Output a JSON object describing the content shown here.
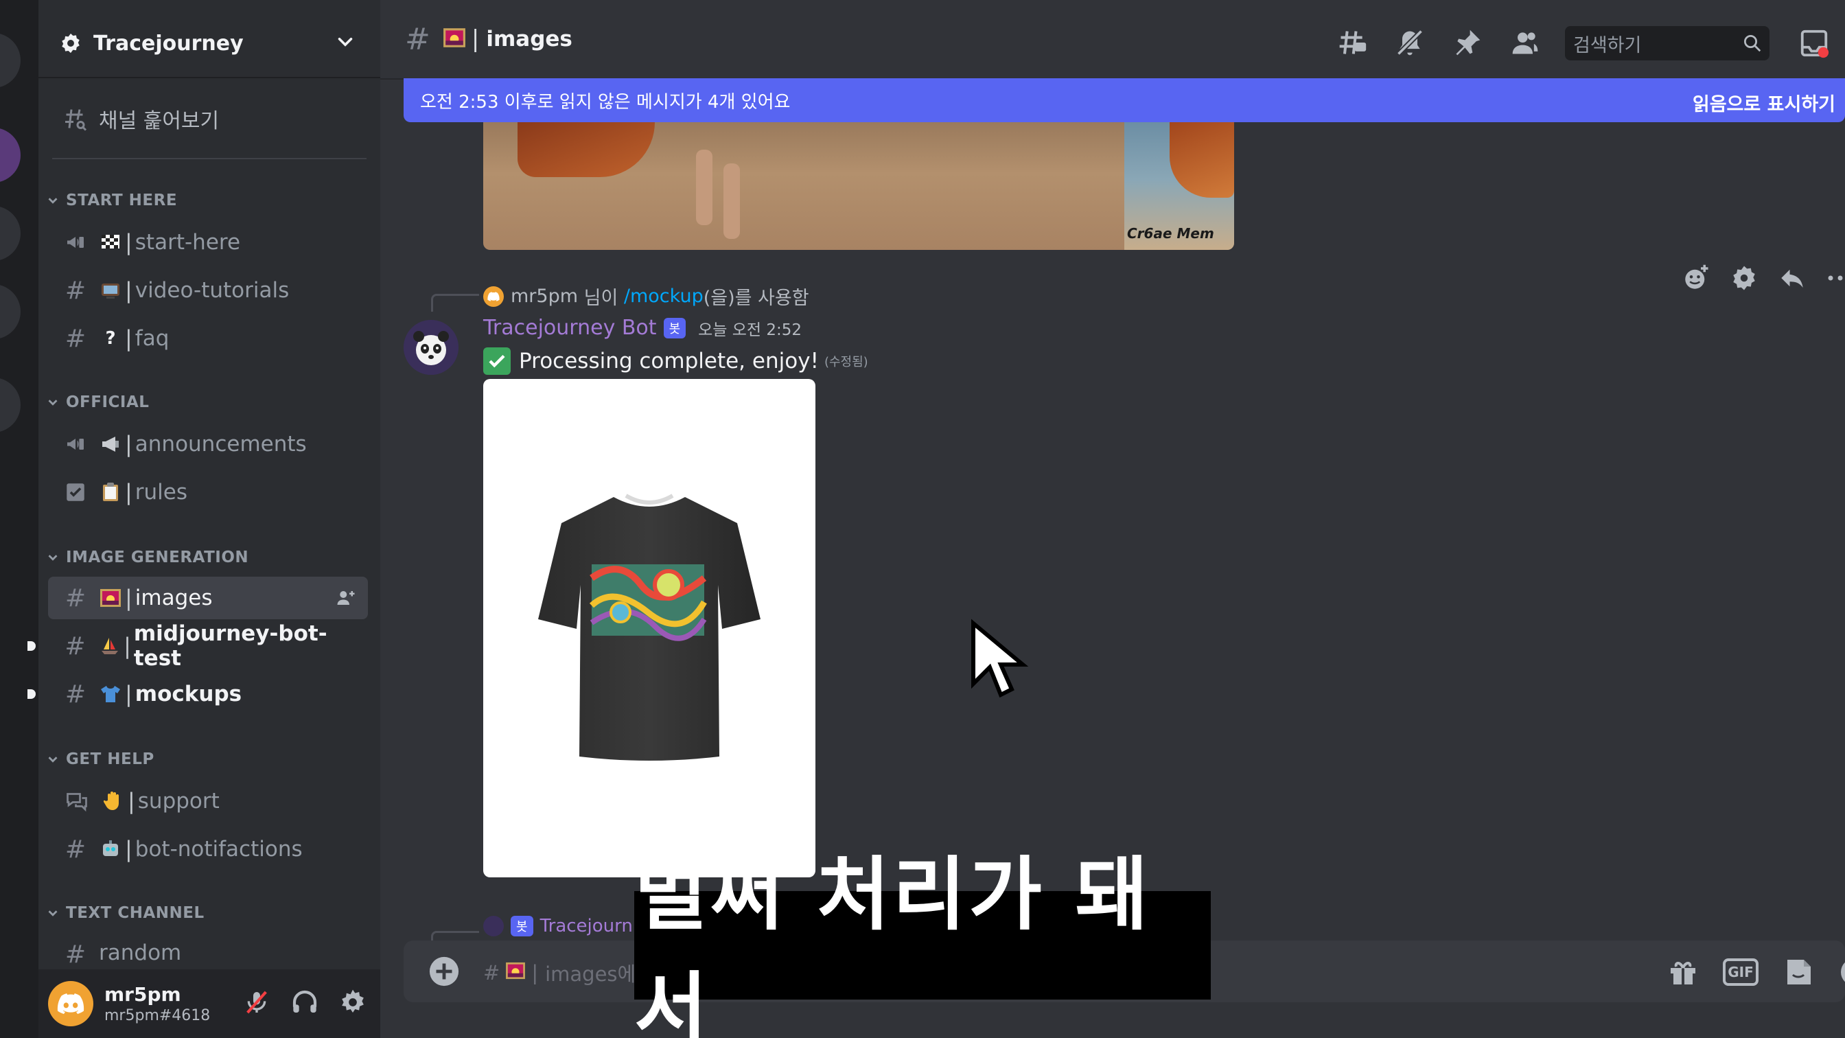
{
  "server": {
    "name": "Tracejourney"
  },
  "browse_channels": "채널 훑어보기",
  "categories": {
    "start_here": "START HERE",
    "official": "OFFICIAL",
    "image_generation": "IMAGE GENERATION",
    "get_help": "GET HELP",
    "text_channel": "TEXT CHANNEL"
  },
  "channels": {
    "start_here": "start-here",
    "video_tutorials": "video-tutorials",
    "faq": "faq",
    "faq_emoji": "?",
    "announcements": "announcements",
    "rules": "rules",
    "images": "images",
    "midjourney_bot_test": "midjourney-bot-test",
    "mockups": "mockups",
    "support": "support",
    "bot_notifactions": "bot-notifactions",
    "random": "random"
  },
  "user": {
    "name": "mr5pm",
    "tag": "mr5pm#4618"
  },
  "topbar": {
    "channel": "images",
    "search_placeholder": "검색하기"
  },
  "new_messages_bar": {
    "text": "오전 2:53 이후로 읽지 않은 메시지가 4개 있어요",
    "action": "읽음으로 표시하기"
  },
  "beach_image": {
    "watermark": "Cr6ae Mem"
  },
  "message": {
    "reply_user": "mr5pm",
    "reply_mid": " 님이 ",
    "reply_command": "/mockup",
    "reply_end": "(을)를 사용함",
    "author": "Tracejourney Bot",
    "bot_badge": "봇",
    "timestamp": "오늘 오전 2:52",
    "text": "Processing complete, enjoy!",
    "edited": "(수정됨)"
  },
  "next_message": {
    "author": "Tracejourn",
    "bot_badge": "봇"
  },
  "composer": {
    "placeholder": "images에"
  },
  "gif_label": "GIF",
  "subtitle": "벌써 처리가 돼서",
  "colors": {
    "accent": "#5865f2",
    "bot_name": "#a47bd6",
    "command": "#00a8fc",
    "background": "#313338",
    "sidebar": "#2b2d31"
  }
}
